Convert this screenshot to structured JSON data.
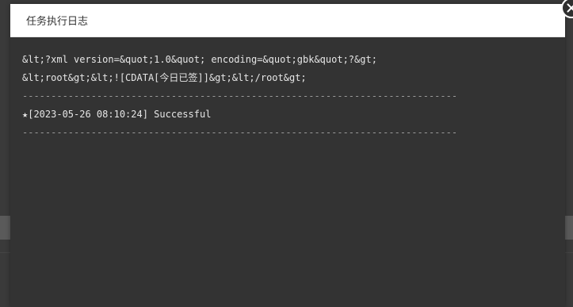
{
  "dialog": {
    "title": "任务执行日志",
    "close_icon": "close-icon"
  },
  "log": {
    "lines": [
      "&lt;?xml version=&quot;1.0&quot; encoding=&quot;gbk&quot;?&gt;",
      "&lt;root&gt;&lt;![CDATA[今日已签]]&gt;&lt;/root&gt;",
      "----------------------------------------------------------------------------",
      "★[2023-05-26 08:10:24] Successful",
      "----------------------------------------------------------------------------"
    ]
  },
  "colors": {
    "log_background": "#333333",
    "log_text": "#e6e6e6",
    "header_background": "#ffffff"
  }
}
